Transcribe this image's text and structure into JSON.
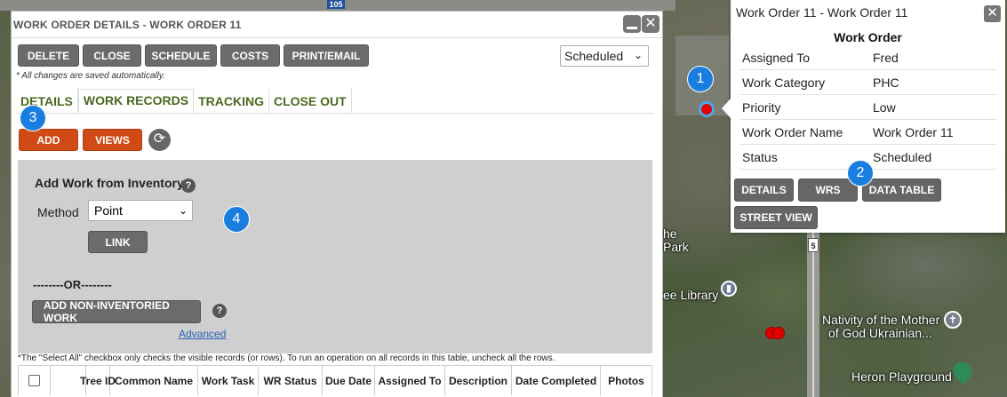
{
  "panel": {
    "title": "WORK ORDER DETAILS - WORK ORDER 11",
    "minimize_icon": "minimize-icon",
    "close_icon": "close-icon",
    "close_glyph": "✕",
    "toolbar": {
      "delete": "DELETE",
      "close": "CLOSE",
      "schedule": "SCHEDULE",
      "costs": "COSTS",
      "print_email": "PRINT/EMAIL"
    },
    "status_value": "Scheduled",
    "autosave_note": "* All changes are saved automatically.",
    "tabs": [
      {
        "label": "DETAILS"
      },
      {
        "label": "WORK RECORDS",
        "active": true
      },
      {
        "label": "TRACKING"
      },
      {
        "label": "CLOSE OUT"
      }
    ],
    "add_button": "ADD",
    "views_button": "VIEWS",
    "refresh_glyph": "⟳",
    "inventory": {
      "title": "Add Work from Inventory",
      "method_label": "Method",
      "method_value": "Point",
      "link_button": "LINK",
      "or_divider": "--------OR--------",
      "non_inventoried_button": "ADD NON-INVENTORIED WORK",
      "advanced_link": "Advanced",
      "help_glyph": "?"
    },
    "footnote": "*The \"Select All\" checkbox only checks the visible records (or rows). To run an operation on all records in this table, uncheck all the rows.",
    "grid_columns": [
      "Tree ID",
      "Common Name",
      "Work Task",
      "WR Status",
      "Due Date",
      "Assigned To",
      "Description",
      "Date Completed",
      "Photos"
    ]
  },
  "popup": {
    "title": "Work Order 11 - Work Order 11",
    "close_glyph": "✕",
    "heading": "Work Order",
    "attributes": [
      {
        "key": "Assigned To",
        "value": "Fred"
      },
      {
        "key": "Work Category",
        "value": "PHC"
      },
      {
        "key": "Priority",
        "value": "Low"
      },
      {
        "key": "Work Order Name",
        "value": "Work Order 11"
      },
      {
        "key": "Status",
        "value": "Scheduled"
      }
    ],
    "buttons": {
      "details": "DETAILS",
      "wrs": "WRS",
      "data_table": "DATA TABLE",
      "street_view": "STREET VIEW"
    }
  },
  "map": {
    "labels": {
      "park_fragment_1": "he",
      "park_fragment_2": "Park",
      "library": "ee Library",
      "church_line1": "Nativity of the Mother",
      "church_line2": "of God Ukrainian...",
      "playground": "Heron Playground"
    },
    "highway_105": "105",
    "highway_5": "5",
    "library_glyph": "▮",
    "church_glyph": "✝"
  },
  "badges": [
    "1",
    "2",
    "3",
    "4"
  ],
  "colors": {
    "accent_orange": "#d04a15",
    "tab_green": "#4a6a1f",
    "badge_blue": "#1a7ee0",
    "button_gray": "#6b6b6b",
    "marker_red": "#e00000"
  }
}
